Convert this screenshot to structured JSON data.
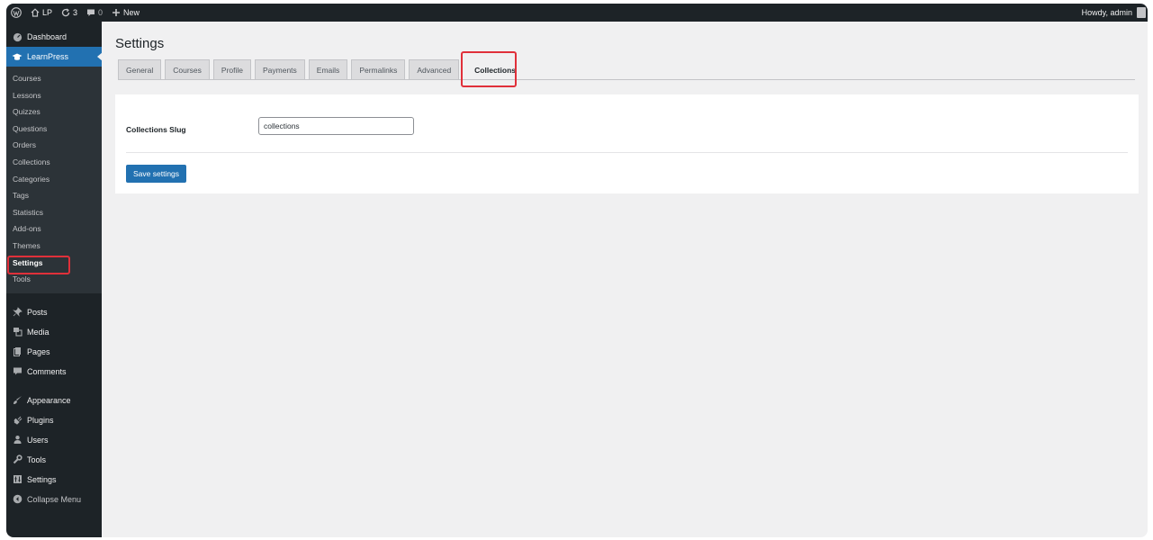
{
  "adminbar": {
    "site_name": "LP",
    "updates_count": "3",
    "comments_count": "0",
    "new_label": "New",
    "greeting": "Howdy, admin"
  },
  "sidebar": {
    "dashboard": "Dashboard",
    "learnpress": "LearnPress",
    "submenu": [
      "Courses",
      "Lessons",
      "Quizzes",
      "Questions",
      "Orders",
      "Collections",
      "Categories",
      "Tags",
      "Statistics",
      "Add-ons",
      "Themes",
      "Settings",
      "Tools"
    ],
    "current_submenu": "Settings",
    "menu": {
      "posts": "Posts",
      "media": "Media",
      "pages": "Pages",
      "comments": "Comments",
      "appearance": "Appearance",
      "plugins": "Plugins",
      "users": "Users",
      "tools": "Tools",
      "settings": "Settings",
      "collapse": "Collapse Menu"
    }
  },
  "page": {
    "title": "Settings",
    "tabs": [
      "General",
      "Courses",
      "Profile",
      "Payments",
      "Emails",
      "Permalinks",
      "Advanced",
      "Collections"
    ],
    "active_tab": "Collections",
    "field_label": "Collections Slug",
    "field_value": "collections",
    "save_label": "Save settings"
  },
  "colors": {
    "admin_dark": "#1d2327",
    "accent": "#2271b1",
    "highlight": "#e0303a"
  }
}
